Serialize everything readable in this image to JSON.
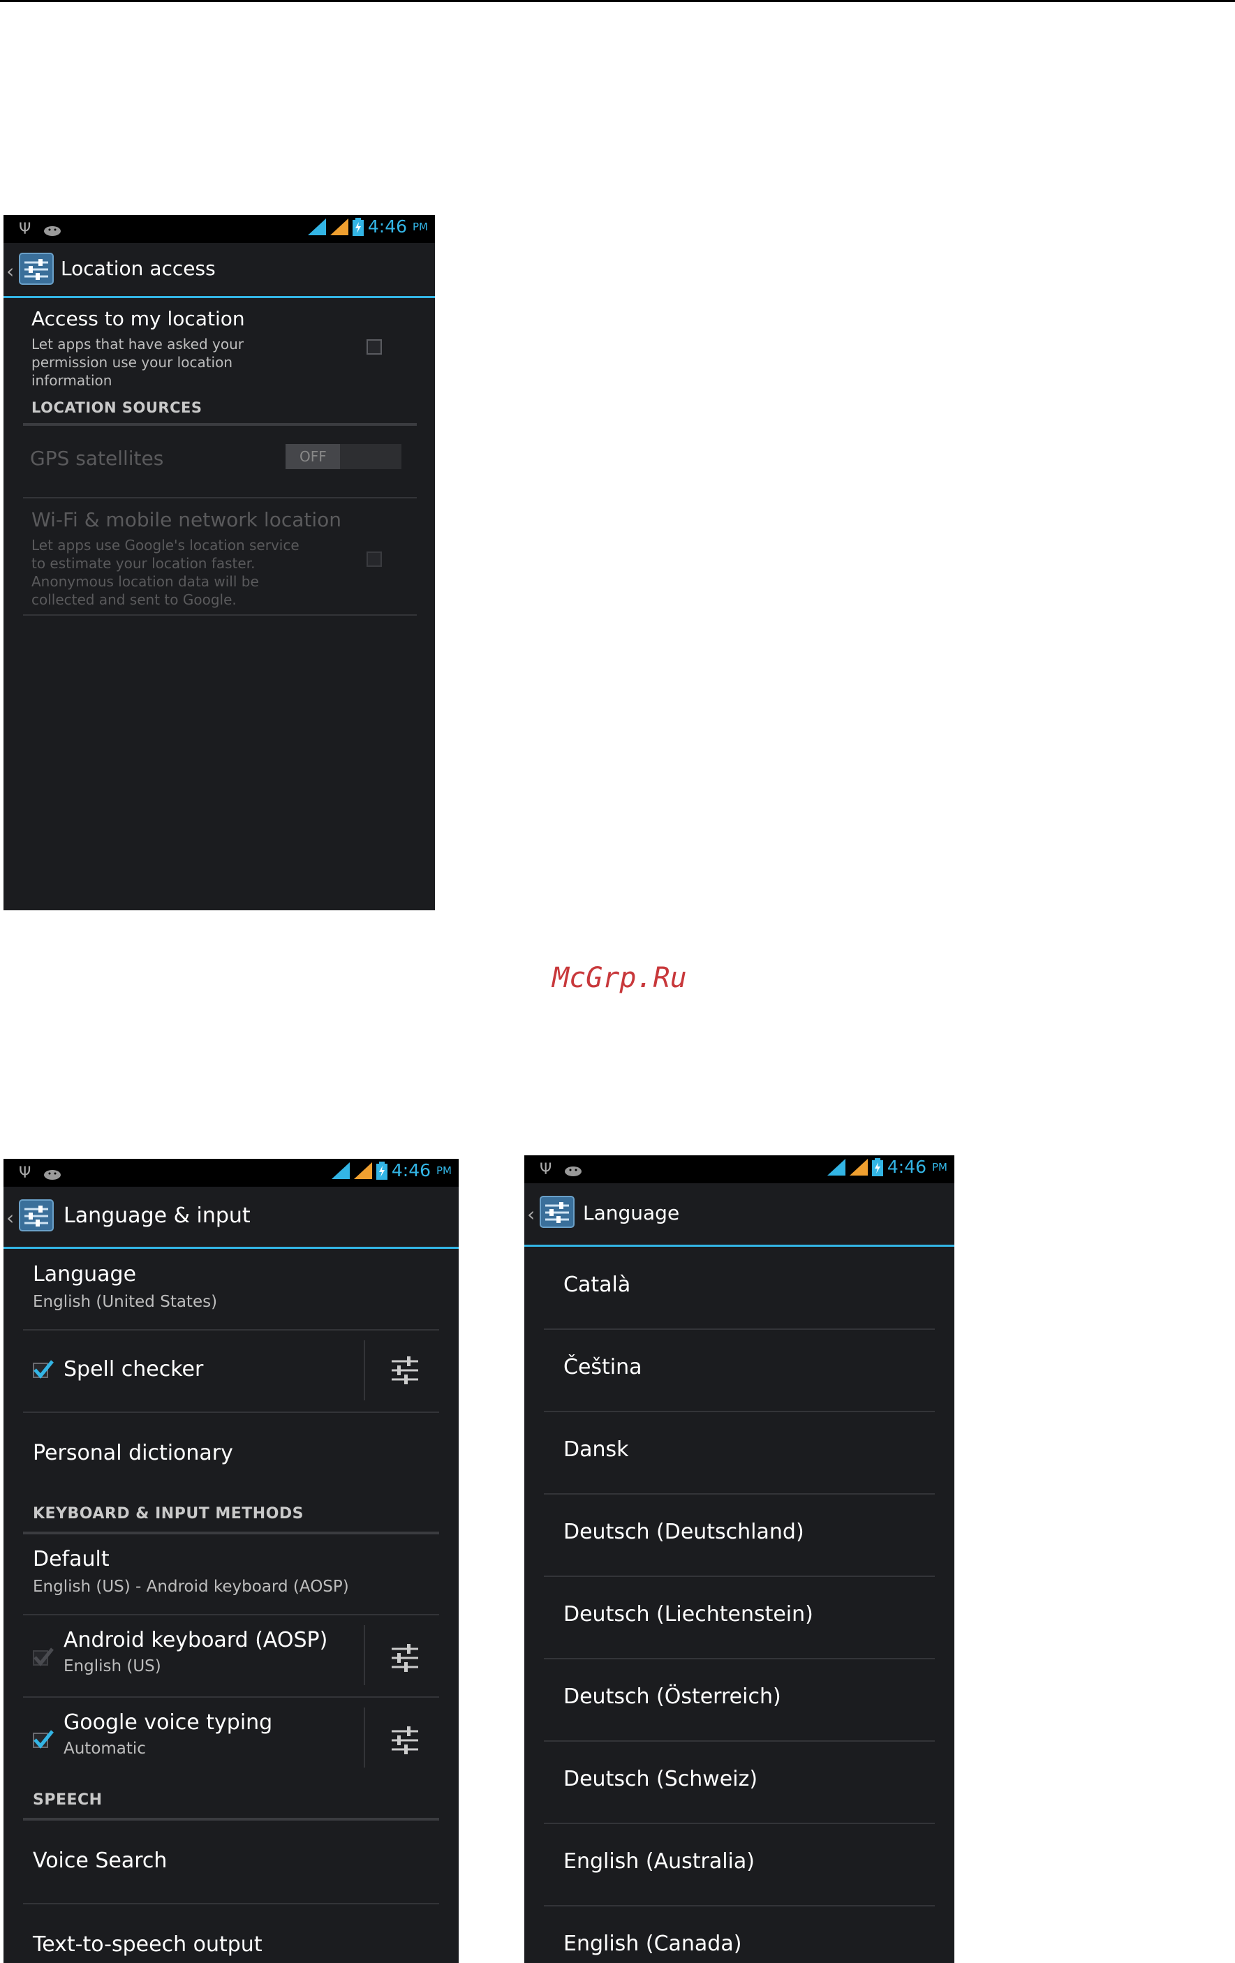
{
  "status_bar": {
    "time": "4:46",
    "ampm": "PM"
  },
  "watermark": "McGrp.Ru",
  "location_screen": {
    "title": "Location access",
    "access_title": "Access to my location",
    "access_desc": [
      "Let apps that have asked your",
      "permission use your location",
      "information"
    ],
    "category": "LOCATION SOURCES",
    "gps_label": "GPS satellites",
    "gps_toggle": "OFF",
    "wifi_title": "Wi-Fi & mobile network location",
    "wifi_desc": [
      "Let apps use Google's location service",
      "to estimate your location faster.",
      "Anonymous location data will be",
      "collected and sent to Google."
    ]
  },
  "input_screen": {
    "title": "Language & input",
    "language_title": "Language",
    "language_sub": "English (United States)",
    "spell_checker": "Spell checker",
    "personal_dictionary": "Personal dictionary",
    "category_keyboard": "KEYBOARD & INPUT METHODS",
    "default_title": "Default",
    "default_sub": "English (US) - Android keyboard (AOSP)",
    "android_keyboard_title": "Android keyboard (AOSP)",
    "android_keyboard_sub": "English (US)",
    "google_voice_title": "Google voice typing",
    "google_voice_sub": "Automatic",
    "category_speech": "SPEECH",
    "voice_search": "Voice Search",
    "tts": "Text-to-speech output"
  },
  "language_screen": {
    "title": "Language",
    "items": [
      "Català",
      "Čeština",
      "Dansk",
      "Deutsch (Deutschland)",
      "Deutsch (Liechtenstein)",
      "Deutsch (Österreich)",
      "Deutsch (Schweiz)",
      "English (Australia)",
      "English (Canada)"
    ]
  }
}
